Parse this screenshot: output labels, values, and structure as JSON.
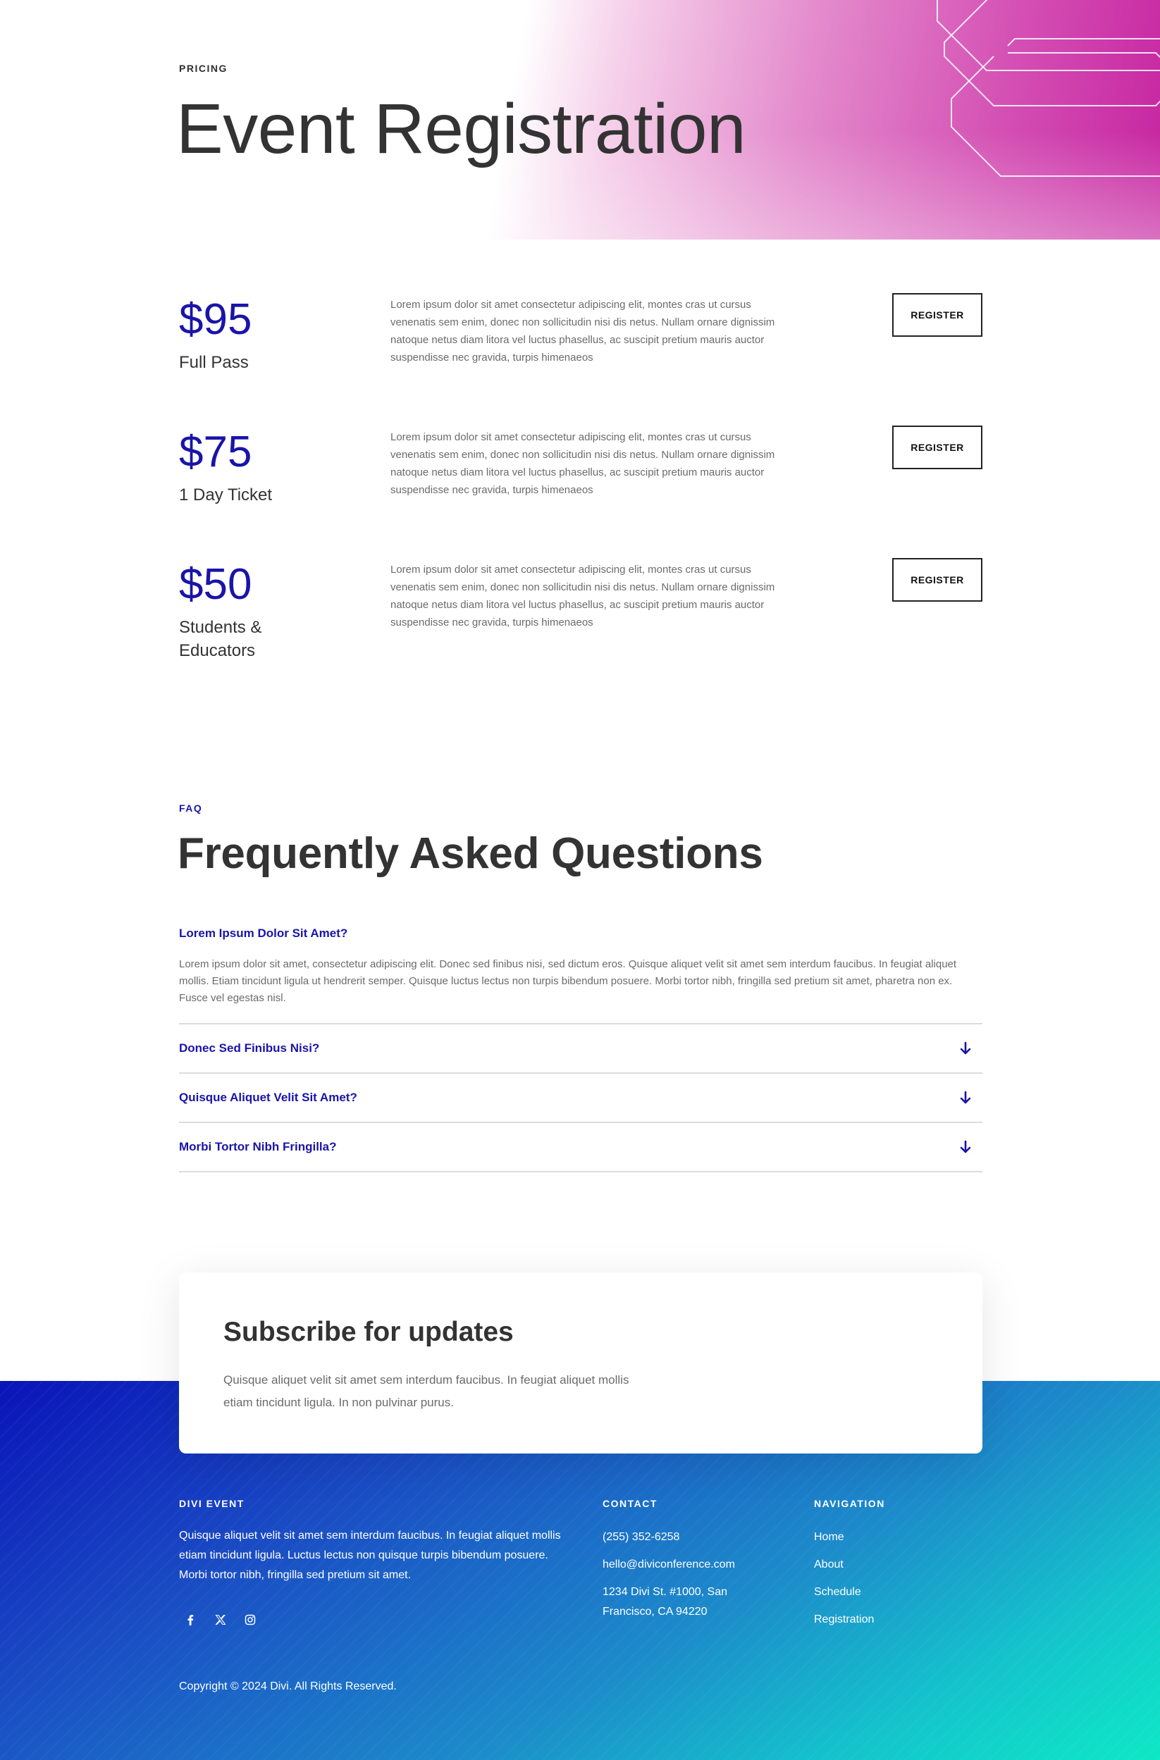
{
  "hero": {
    "eyebrow": "PRICING",
    "title": "Event Registration"
  },
  "pricing": {
    "register_label": "REGISTER",
    "tiers": [
      {
        "price": "$95",
        "name": "Full Pass",
        "description": "Lorem ipsum dolor sit amet consectetur adipiscing elit, montes cras ut cursus venenatis sem enim, donec non sollicitudin nisi dis netus. Nullam ornare dignissim natoque netus diam litora vel luctus phasellus, ac suscipit pretium mauris auctor suspendisse nec gravida, turpis himenaeos"
      },
      {
        "price": "$75",
        "name": "1 Day Ticket",
        "description": "Lorem ipsum dolor sit amet consectetur adipiscing elit, montes cras ut cursus venenatis sem enim, donec non sollicitudin nisi dis netus. Nullam ornare dignissim natoque netus diam litora vel luctus phasellus, ac suscipit pretium mauris auctor suspendisse nec gravida, turpis himenaeos"
      },
      {
        "price": "$50",
        "name": "Students & Educators",
        "description": "Lorem ipsum dolor sit amet consectetur adipiscing elit, montes cras ut cursus venenatis sem enim, donec non sollicitudin nisi dis netus. Nullam ornare dignissim natoque netus diam litora vel luctus phasellus, ac suscipit pretium mauris auctor suspendisse nec gravida, turpis himenaeos"
      }
    ]
  },
  "faq": {
    "eyebrow": "FAQ",
    "title": "Frequently Asked Questions",
    "open_item": {
      "question": "Lorem Ipsum Dolor Sit Amet?",
      "answer": "Lorem ipsum dolor sit amet, consectetur adipiscing elit. Donec sed finibus nisi, sed dictum eros. Quisque aliquet velit sit amet sem interdum faucibus. In feugiat aliquet mollis. Etiam tincidunt ligula ut hendrerit semper. Quisque luctus lectus non turpis bibendum posuere. Morbi tortor nibh, fringilla sed pretium sit amet, pharetra non ex. Fusce vel egestas nisl."
    },
    "closed_items": [
      {
        "question": "Donec Sed Finibus Nisi?"
      },
      {
        "question": "Quisque Aliquet Velit Sit Amet?"
      },
      {
        "question": "Morbi Tortor Nibh Fringilla?"
      }
    ]
  },
  "subscribe": {
    "title": "Subscribe for updates",
    "text": "Quisque aliquet velit sit amet sem interdum faucibus. In feugiat aliquet mollis etiam tincidunt ligula. In non pulvinar purus."
  },
  "footer": {
    "about_title": "DIVI EVENT",
    "about_text": "Quisque aliquet velit sit amet sem interdum faucibus. In feugiat aliquet mollis etiam tincidunt ligula. Luctus lectus non quisque turpis bibendum posuere. Morbi tortor nibh, fringilla sed pretium sit amet.",
    "contact_title": "CONTACT",
    "phone": "(255) 352-6258",
    "email": "hello@diviconference.com",
    "address": "1234 Divi St. #1000, San Francisco, CA 94220",
    "nav_title": "NAVIGATION",
    "nav_links": [
      "Home",
      "About",
      "Schedule",
      "Registration"
    ],
    "social_icons": [
      "facebook-icon",
      "x-icon",
      "instagram-icon"
    ],
    "copyright": "Copyright © 2024 Divi. All Rights Reserved."
  },
  "colors": {
    "accent": "#1a14a8",
    "hero_magenta": "#c624a0",
    "footer_blue": "#0a14b8",
    "footer_teal": "#0ee8c6"
  }
}
